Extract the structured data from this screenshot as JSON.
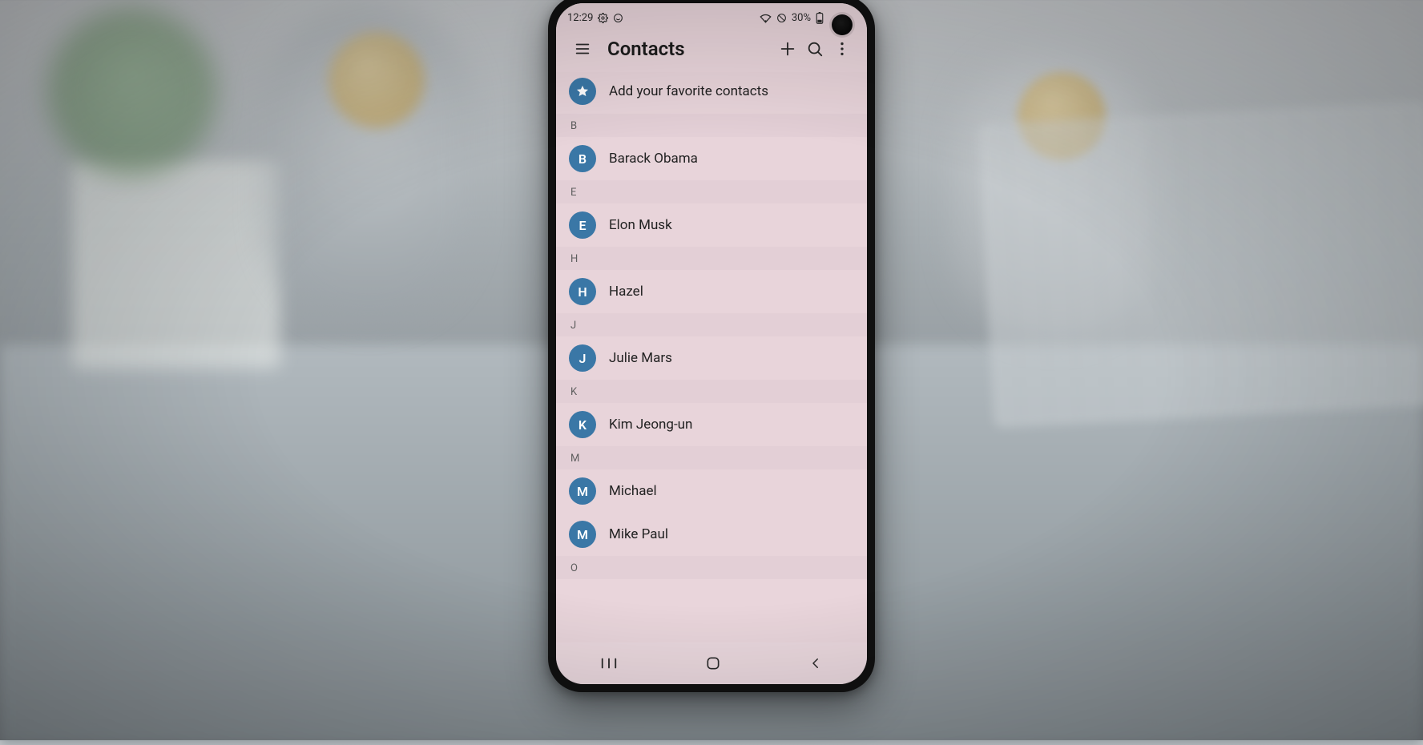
{
  "status": {
    "time": "12:29",
    "battery_text": "30%"
  },
  "header": {
    "title": "Contacts"
  },
  "favorite_prompt": "Add your favorite contacts",
  "sections": [
    {
      "letter": "B",
      "contacts": [
        {
          "initial": "B",
          "name": "Barack Obama"
        }
      ]
    },
    {
      "letter": "E",
      "contacts": [
        {
          "initial": "E",
          "name": "Elon Musk"
        }
      ]
    },
    {
      "letter": "H",
      "contacts": [
        {
          "initial": "H",
          "name": "Hazel"
        }
      ]
    },
    {
      "letter": "J",
      "contacts": [
        {
          "initial": "J",
          "name": "Julie Mars"
        }
      ]
    },
    {
      "letter": "K",
      "contacts": [
        {
          "initial": "K",
          "name": "Kim Jeong-un"
        }
      ]
    },
    {
      "letter": "M",
      "contacts": [
        {
          "initial": "M",
          "name": "Michael"
        },
        {
          "initial": "M",
          "name": "Mike Paul"
        }
      ]
    },
    {
      "letter": "O",
      "contacts": []
    }
  ]
}
